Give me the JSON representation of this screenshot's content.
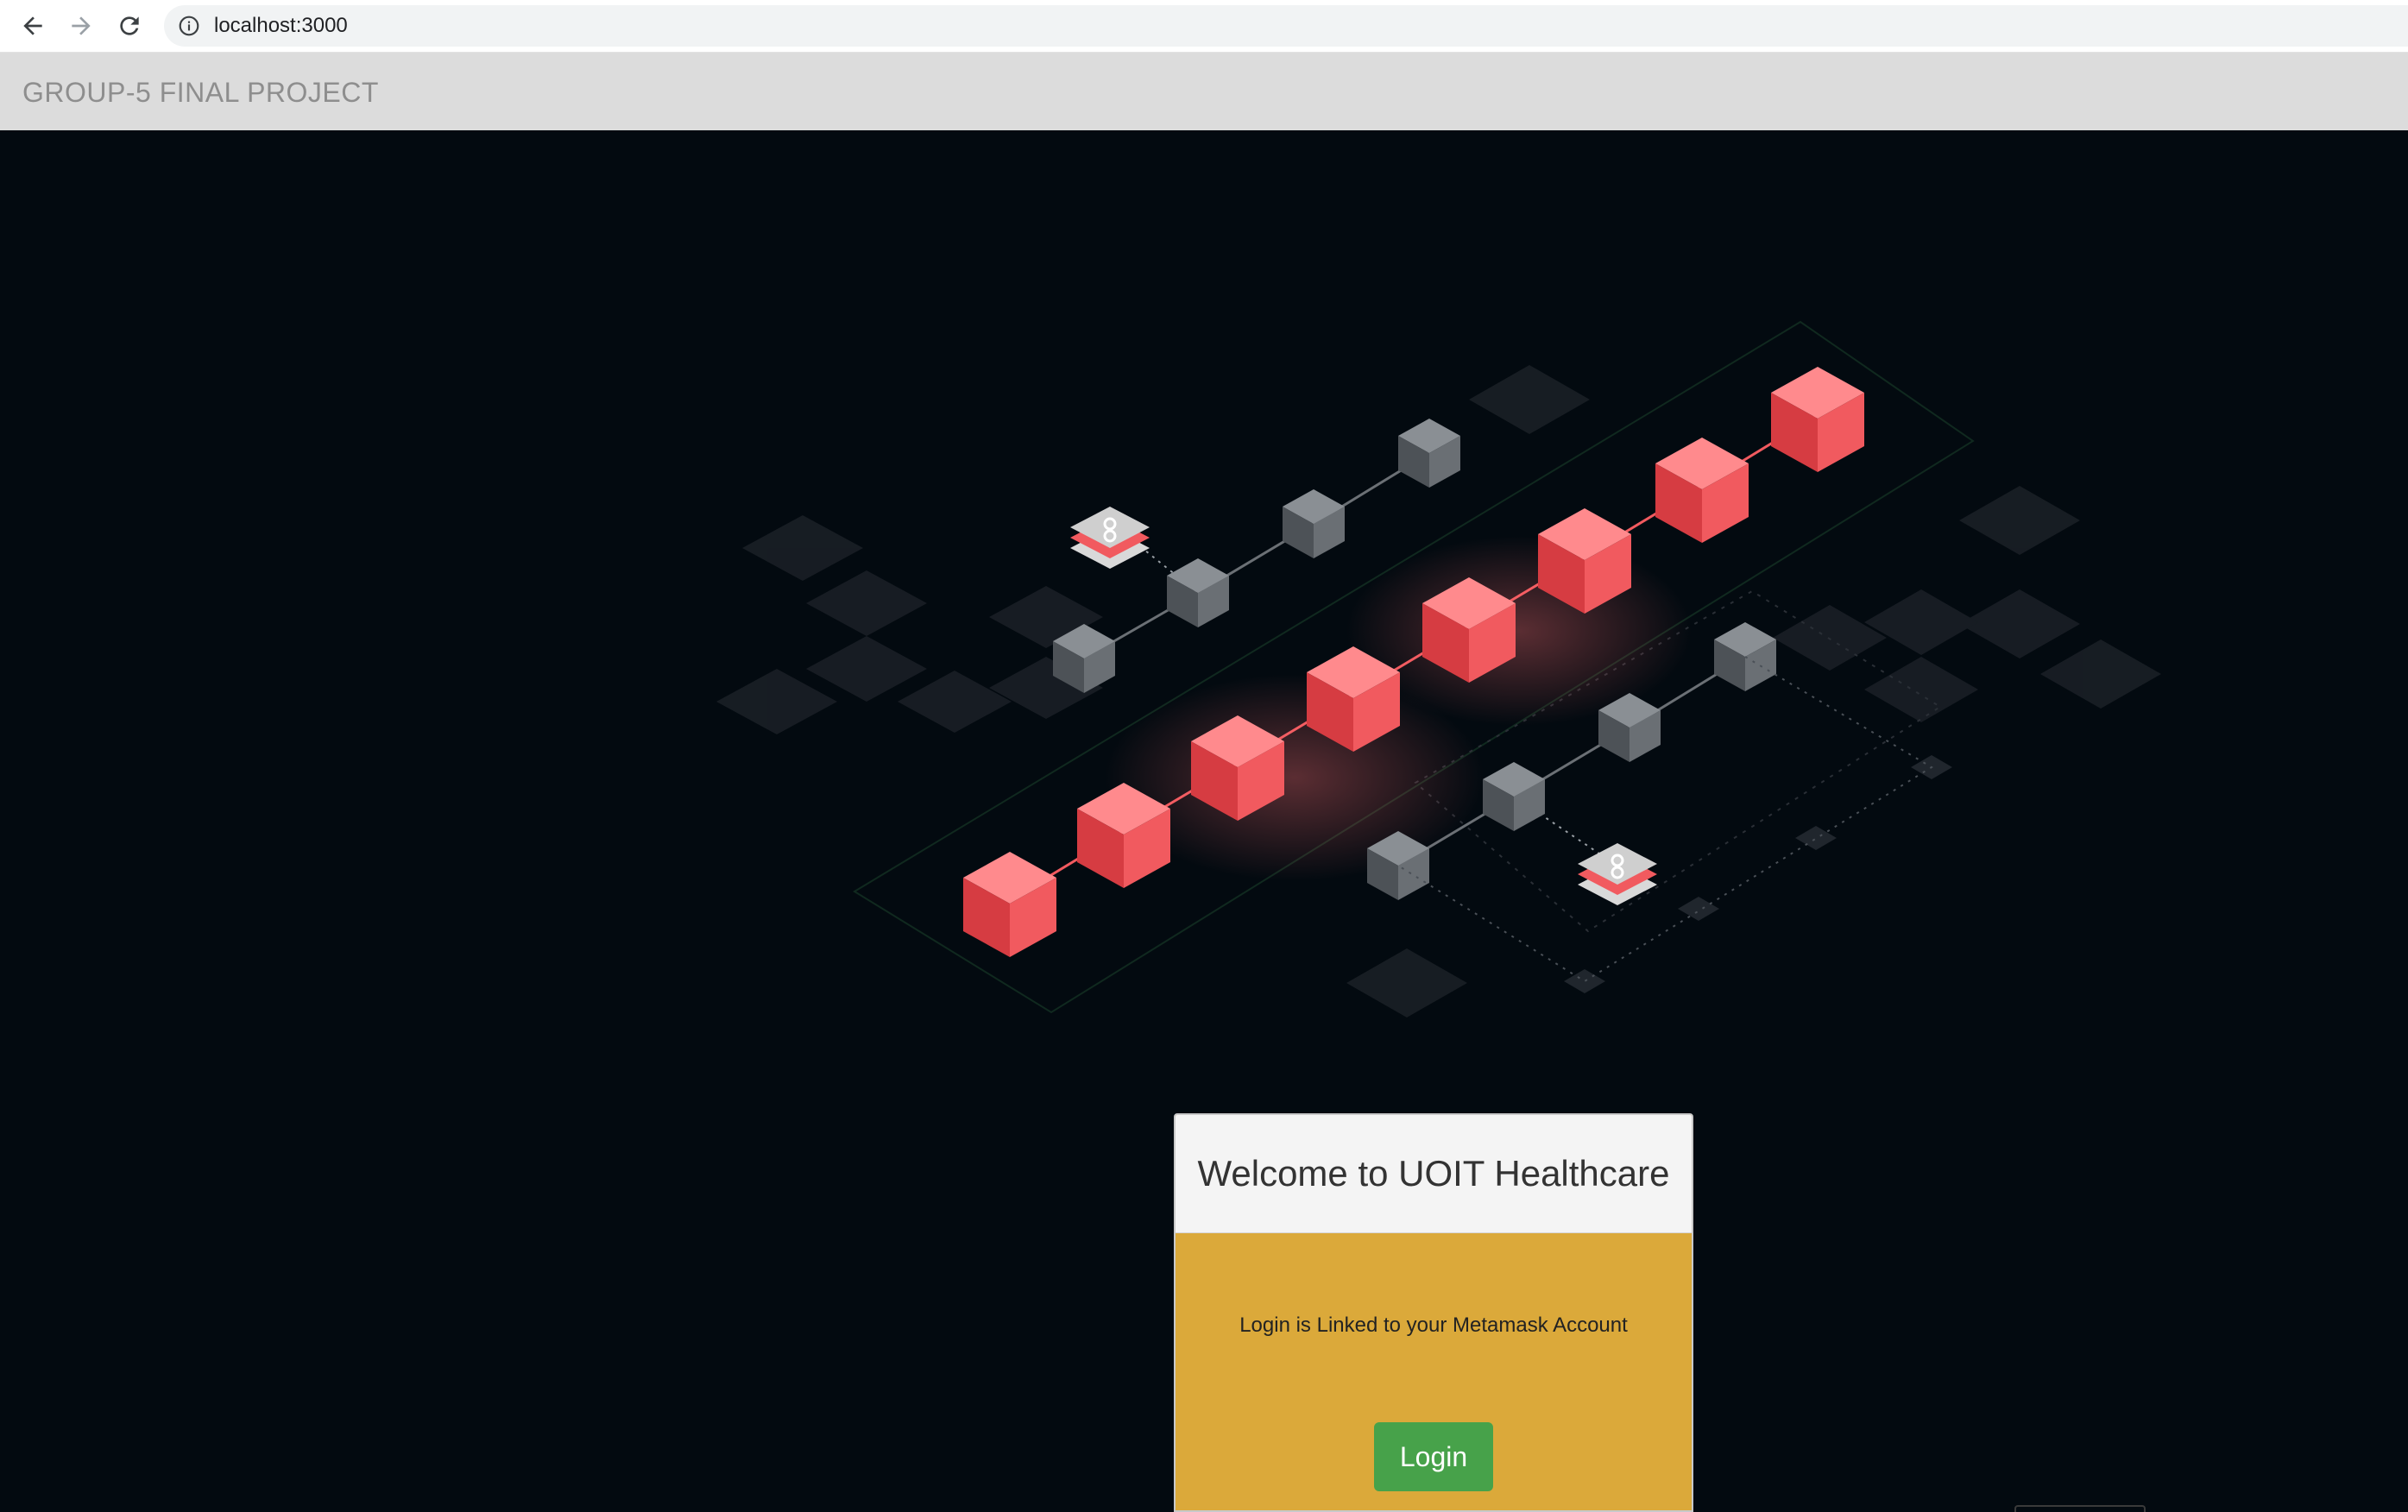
{
  "browser": {
    "url": "localhost:3000",
    "icons": {
      "back": "arrow-left-icon",
      "forward": "arrow-right-icon",
      "reload": "reload-icon",
      "info": "info-icon"
    }
  },
  "header": {
    "title": "GROUP-5 FINAL PROJECT"
  },
  "login_card": {
    "title": "Welcome to UOIT Healthcare",
    "message": "Login is Linked to your Metamask Account",
    "button_label": "Login"
  },
  "colors": {
    "page_background": "#030a10",
    "header_background": "#dcdcdc",
    "header_text": "#8e8e8e",
    "card_body": "#dba93a",
    "card_header": "#f4f4f4",
    "login_button": "#47a24a",
    "block_red": "#f15a5f",
    "block_gray": "#5a5f63"
  }
}
